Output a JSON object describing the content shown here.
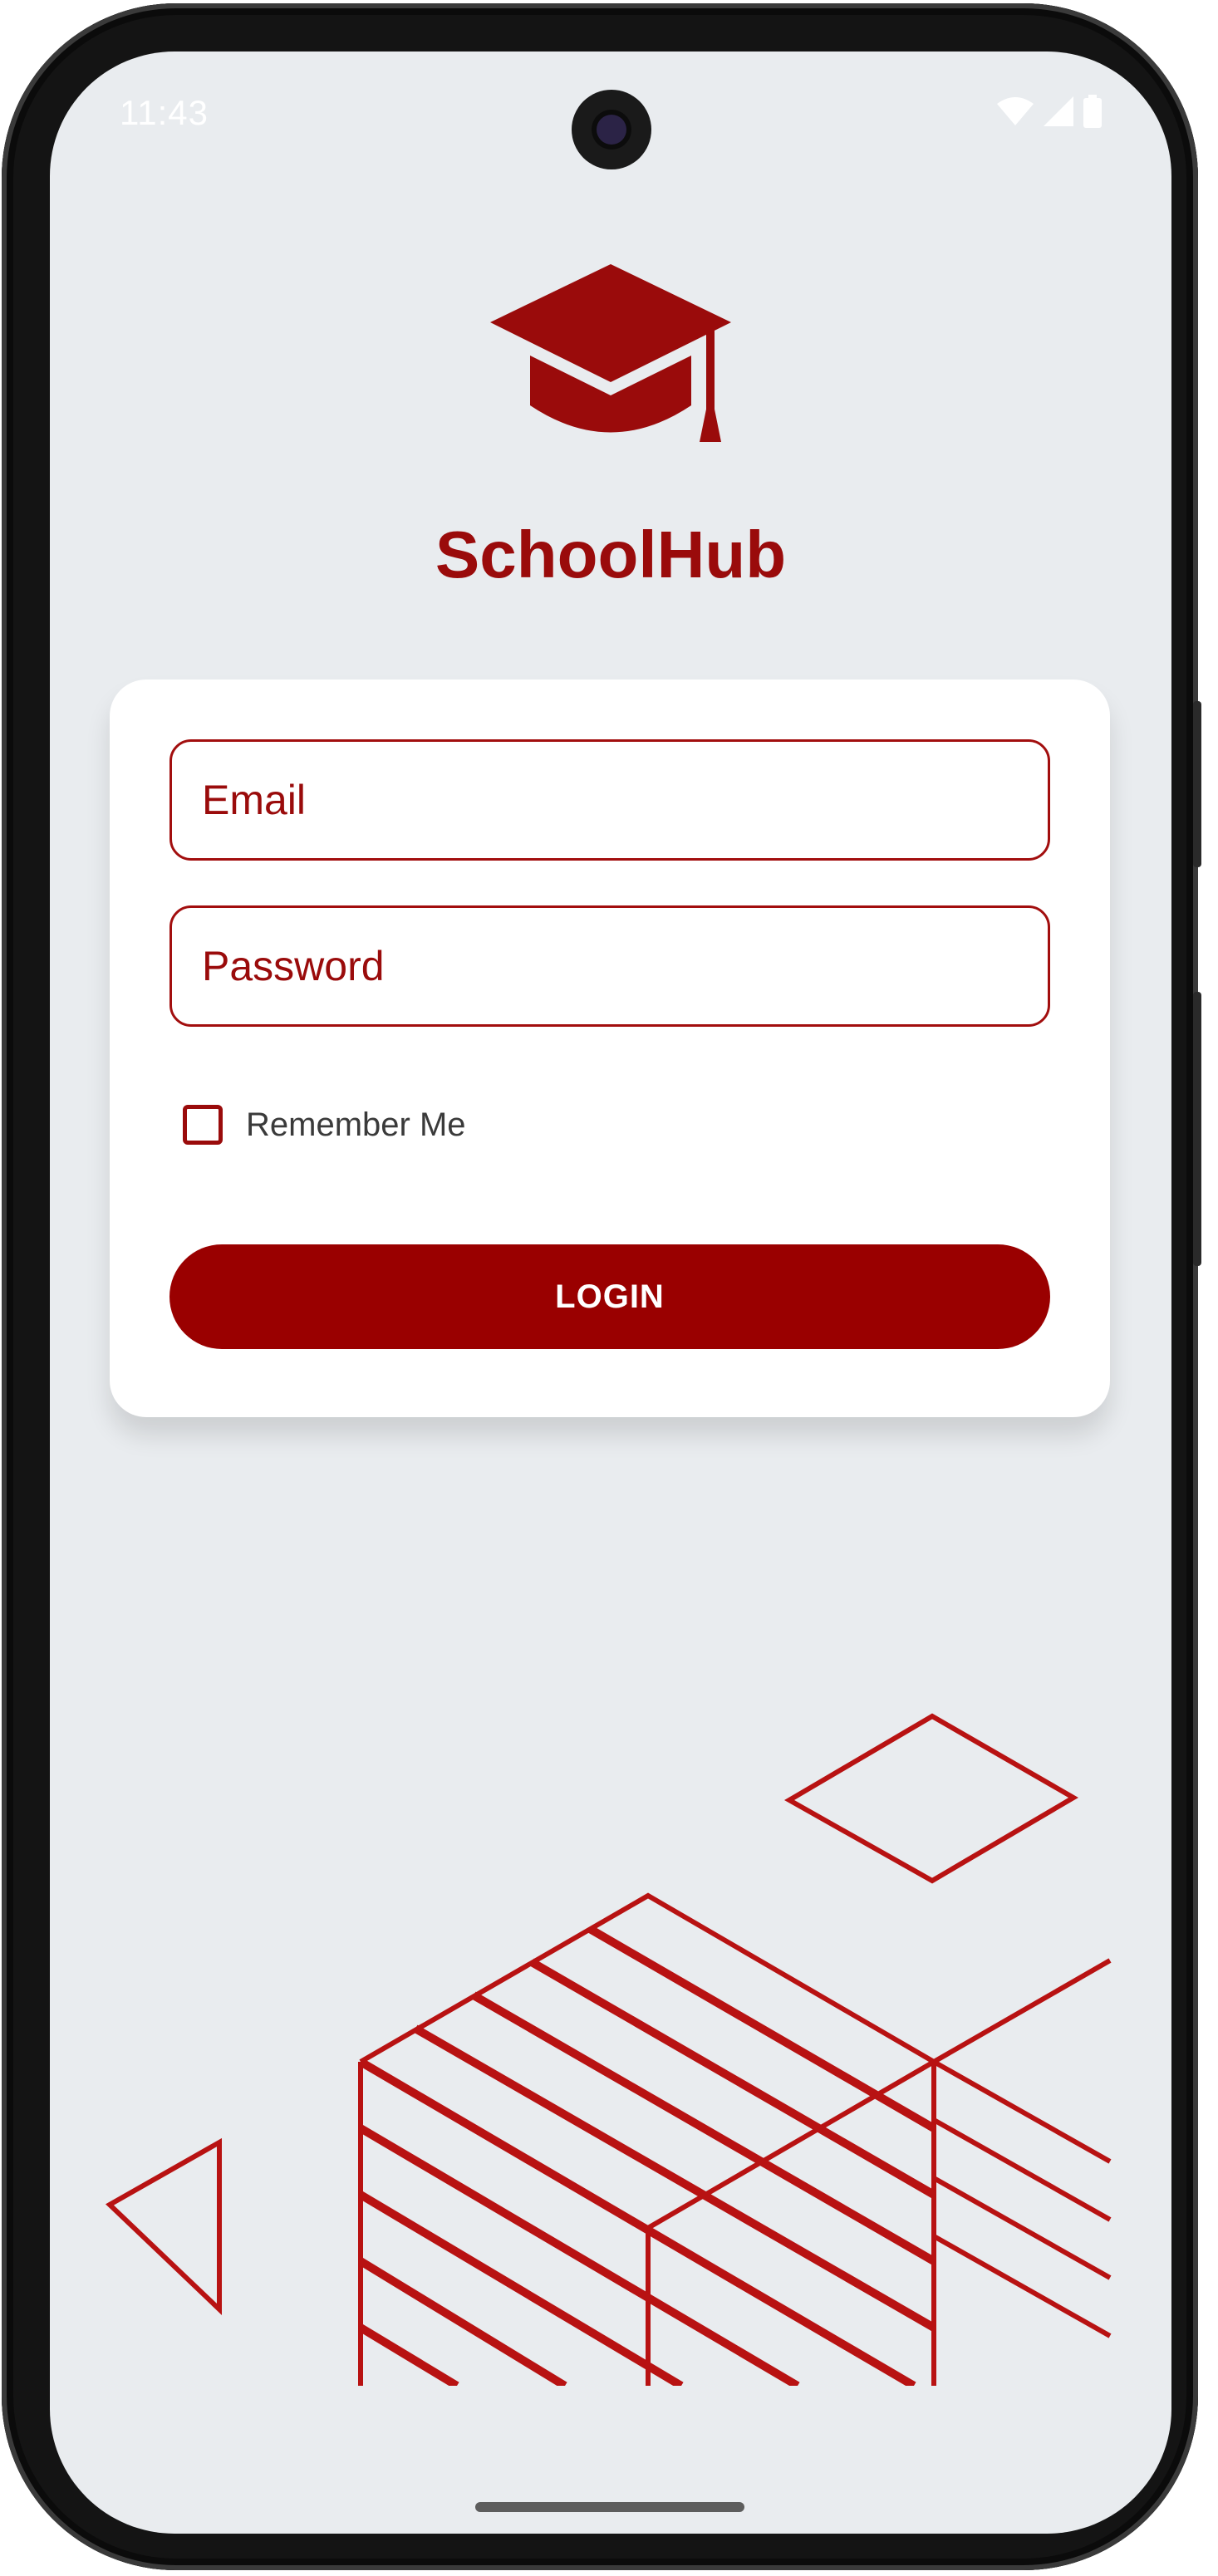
{
  "status_bar": {
    "time": "11:43",
    "icons": [
      "wifi-icon",
      "signal-icon",
      "battery-icon"
    ]
  },
  "app": {
    "logo_icon": "graduation-cap-icon",
    "name": "SchoolHub"
  },
  "login_form": {
    "email_placeholder": "Email",
    "password_placeholder": "Password",
    "remember_label": "Remember Me",
    "remember_checked": false,
    "login_label": "LOGIN"
  },
  "colors": {
    "brand": "#9a0000",
    "background": "#e9ecef",
    "card": "#ffffff"
  }
}
